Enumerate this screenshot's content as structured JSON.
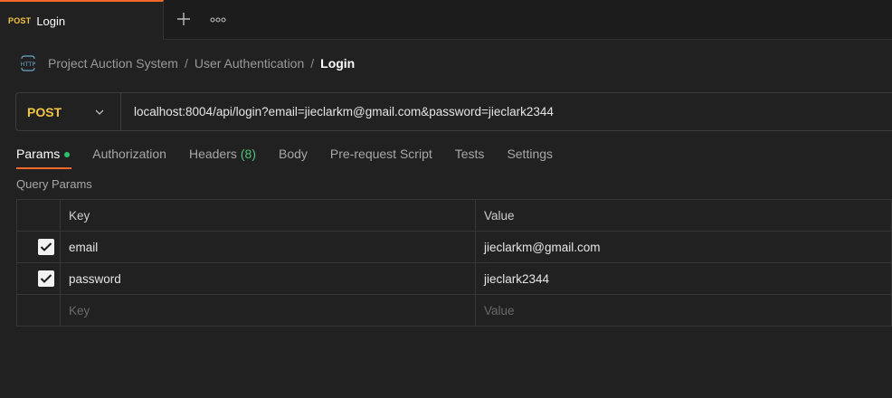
{
  "tab": {
    "method": "POST",
    "name": "Login"
  },
  "breadcrumb": {
    "icon": "http-icon",
    "items": [
      "Project Auction System",
      "User Authentication"
    ],
    "separator": "/",
    "current": "Login"
  },
  "request": {
    "method": "POST",
    "url": "localhost:8004/api/login?email=jieclarkm@gmail.com&password=jieclark2344"
  },
  "req_tabs": {
    "params": "Params",
    "authorization": "Authorization",
    "headers": "Headers",
    "headers_count": "(8)",
    "body": "Body",
    "pre_request": "Pre-request Script",
    "tests": "Tests",
    "settings": "Settings"
  },
  "query_params": {
    "title": "Query Params",
    "columns": {
      "key": "Key",
      "value": "Value"
    },
    "rows": [
      {
        "checked": true,
        "key": "email",
        "value": "jieclarkm@gmail.com"
      },
      {
        "checked": true,
        "key": "password",
        "value": "jieclark2344"
      }
    ],
    "placeholder": {
      "key": "Key",
      "value": "Value"
    }
  },
  "colors": {
    "accent": "#f2672a",
    "post": "#f4c542",
    "green": "#2dc26b"
  }
}
